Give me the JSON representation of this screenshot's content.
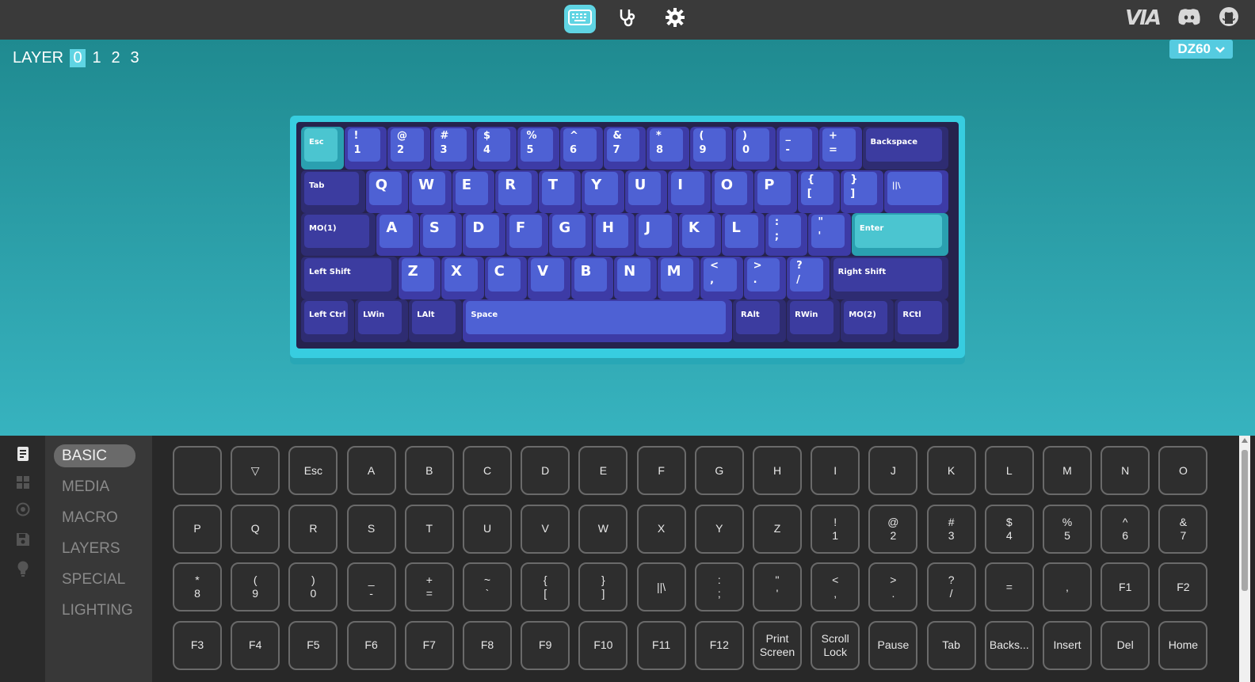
{
  "topbar": {
    "brand": "VIA",
    "icons": [
      "keyboard-icon",
      "stethoscope-icon",
      "gear-icon",
      "discord-icon",
      "github-icon"
    ]
  },
  "layers": {
    "label": "LAYER",
    "items": [
      "0",
      "1",
      "2",
      "3"
    ],
    "active": "0"
  },
  "device": {
    "name": "DZ60"
  },
  "keyboard": {
    "rows": [
      [
        "Esc",
        "!|1",
        "@|2",
        "#|3",
        "$|4",
        "%|5",
        "^|6",
        "&|7",
        "*|8",
        "(|9",
        ")|0",
        "_|-",
        "+|=",
        "Backspace"
      ],
      [
        "Tab",
        "Q",
        "W",
        "E",
        "R",
        "T",
        "Y",
        "U",
        "I",
        "O",
        "P",
        "{|[",
        "}|]",
        "||\\"
      ],
      [
        "MO(1)",
        "A",
        "S",
        "D",
        "F",
        "G",
        "H",
        "J",
        "K",
        "L",
        ":|;",
        "\"|'",
        "Enter"
      ],
      [
        "Left Shift",
        "Z",
        "X",
        "C",
        "V",
        "B",
        "N",
        "M",
        "<|,",
        ">|.",
        "?|/",
        "Right Shift"
      ],
      [
        "Left Ctrl",
        "LWin",
        "LAlt",
        "Space",
        "RAlt",
        "RWin",
        "MO(2)",
        "RCtl"
      ]
    ]
  },
  "menu": {
    "items": [
      "BASIC",
      "MEDIA",
      "MACRO",
      "LAYERS",
      "SPECIAL",
      "LIGHTING"
    ],
    "active": "BASIC",
    "side_icons": [
      "document-icon",
      "grid-icon",
      "target-icon",
      "save-icon",
      "bulb-icon"
    ]
  },
  "keycodes": {
    "rows": [
      [
        "",
        "▽",
        "Esc",
        "A",
        "B",
        "C",
        "D",
        "E",
        "F",
        "G",
        "H",
        "I",
        "J",
        "K",
        "L",
        "M",
        "N",
        "O"
      ],
      [
        "P",
        "Q",
        "R",
        "S",
        "T",
        "U",
        "V",
        "W",
        "X",
        "Y",
        "Z",
        "!|1",
        "@|2",
        "#|3",
        "$|4",
        "%|5",
        "^|6",
        "&|7"
      ],
      [
        "*|8",
        "(|9",
        ")|0",
        "_|-",
        "+|=",
        "~|`",
        "{|[",
        "}|]",
        "||\\",
        ":|;",
        "\"|'",
        "<|,",
        ">|.",
        "?|/",
        "=",
        ",",
        "F1",
        "F2"
      ],
      [
        "F3",
        "F4",
        "F5",
        "F6",
        "F7",
        "F8",
        "F9",
        "F10",
        "F11",
        "F12",
        "Print|Screen",
        "Scroll|Lock",
        "Pause",
        "Tab",
        "Backs...",
        "Insert",
        "Del",
        "Home"
      ]
    ]
  },
  "colors": {
    "accent": "#5fd4e3",
    "keycap_blue": "#4e61d4",
    "keycap_dark": "#3c3ca0",
    "keycap_teal": "#4bc5d0",
    "case": "#37cde0"
  }
}
